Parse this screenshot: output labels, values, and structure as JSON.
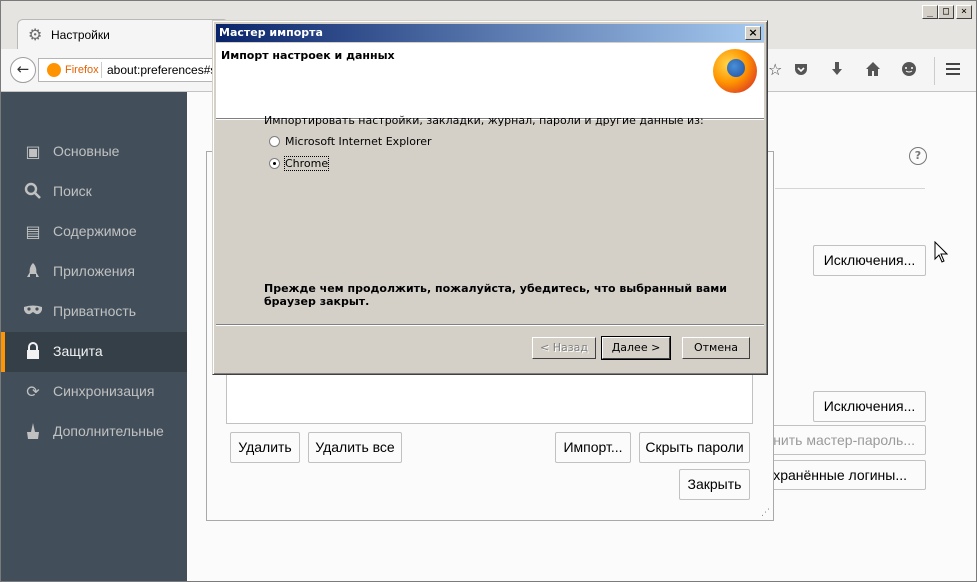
{
  "browser": {
    "tab_label": "Настройки",
    "identity_label": "Firefox",
    "url": "about:preferences#se"
  },
  "sidebar": {
    "items": [
      {
        "label": "Основные",
        "icon": "general-icon"
      },
      {
        "label": "Поиск",
        "icon": "search-icon"
      },
      {
        "label": "Содержимое",
        "icon": "content-icon"
      },
      {
        "label": "Приложения",
        "icon": "applications-icon"
      },
      {
        "label": "Приватность",
        "icon": "privacy-mask-icon"
      },
      {
        "label": "Защита",
        "icon": "security-lock-icon"
      },
      {
        "label": "Синхронизация",
        "icon": "sync-icon"
      },
      {
        "label": "Дополнительные",
        "icon": "advanced-icon"
      }
    ],
    "active_index": 5
  },
  "main": {
    "exceptions_label": "Исключения...",
    "exceptions_label_2": "Исключения...",
    "master_password_partial": "нить мастер-пароль...",
    "saved_logins_partial": "хранённые логины..."
  },
  "logins_dialog": {
    "delete_label": "Удалить",
    "delete_all_label": "Удалить все",
    "import_label": "Импорт...",
    "hide_passwords_label": "Скрыть пароли",
    "close_label": "Закрыть"
  },
  "wizard": {
    "title": "Мастер импорта",
    "heading": "Импорт настроек и данных",
    "prompt": "Импортировать настройки, закладки, журнал, пароли и другие данные из:",
    "options": [
      "Microsoft Internet Explorer",
      "Chrome"
    ],
    "selected": "Chrome",
    "warning_line1": "Прежде чем продолжить, пожалуйста, убедитесь, что выбранный вами",
    "warning_line2": "браузер закрыт.",
    "back_label": "< Назад",
    "next_label": "Далее >",
    "cancel_label": "Отмена"
  },
  "colors": {
    "sidebar_bg": "#424f5a",
    "sidebar_active_bg": "#343f48",
    "accent": "#ff9500",
    "wizard_title_start": "#0a246a",
    "wizard_title_end": "#a6caf0"
  }
}
